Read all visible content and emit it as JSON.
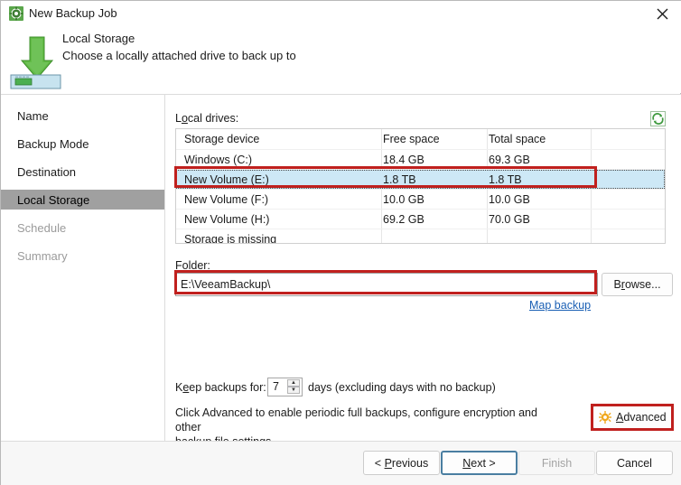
{
  "window": {
    "title": "New Backup Job",
    "app_icon": "gear-icon",
    "close_label": "✕"
  },
  "header": {
    "icon": "download-to-drive-icon",
    "title": "Local Storage",
    "subtitle": "Choose a locally attached drive to back up to"
  },
  "sidebar": {
    "items": [
      {
        "label": "Name",
        "state": "normal"
      },
      {
        "label": "Backup Mode",
        "state": "normal"
      },
      {
        "label": "Destination",
        "state": "normal"
      },
      {
        "label": "Local Storage",
        "state": "selected"
      },
      {
        "label": "Schedule",
        "state": "disabled"
      },
      {
        "label": "Summary",
        "state": "disabled"
      }
    ]
  },
  "main": {
    "drives_label": "Local drives:",
    "refresh_icon": "refresh-icon",
    "table": {
      "columns": [
        "Storage device",
        "Free space",
        "Total space"
      ],
      "rows": [
        {
          "device": "Windows (C:)",
          "free": "18.4 GB",
          "total": "69.3 GB",
          "selected": false
        },
        {
          "device": "New Volume (E:)",
          "free": "1.8 TB",
          "total": "1.8 TB",
          "selected": true
        },
        {
          "device": "New Volume (F:)",
          "free": "10.0 GB",
          "total": "10.0 GB",
          "selected": false
        },
        {
          "device": "New Volume (H:)",
          "free": "69.2 GB",
          "total": "70.0 GB",
          "selected": false
        },
        {
          "device": "Storage is missing",
          "free": "",
          "total": "",
          "selected": false
        }
      ]
    },
    "folder_label": "Folder:",
    "folder_value": "E:\\VeeamBackup\\",
    "folder_placeholder": "",
    "browse_label": "Browse...",
    "map_backup_label": "Map backup",
    "keep_backups_label": "Keep backups for:",
    "keep_backups_value": "7",
    "keep_backups_suffix": "days (excluding days with no backup)",
    "advanced_info_line1": "Click Advanced to enable periodic full backups, configure encryption and other",
    "advanced_info_line2": "backup file settings",
    "advanced_label": "Advanced",
    "advanced_icon": "gear-icon"
  },
  "footer": {
    "previous_label": "< Previous",
    "next_label": "Next >",
    "finish_label": "Finish",
    "cancel_label": "Cancel"
  },
  "colors": {
    "annotation_red": "#c0201e",
    "selection_blue": "#cde8f6",
    "sidebar_selected": "#a0a0a0",
    "link_blue": "#1a5fb4",
    "accent_green": "#4caf50",
    "gear_orange": "#f0a81e"
  }
}
